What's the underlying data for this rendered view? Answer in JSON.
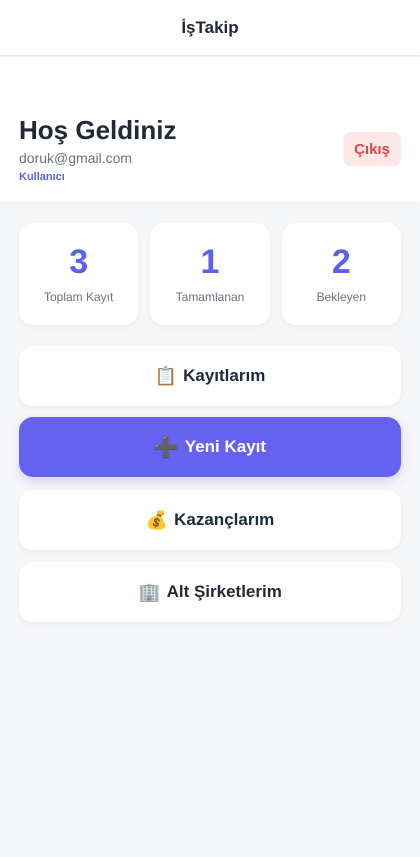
{
  "header": {
    "title": "İşTakip"
  },
  "welcome": {
    "greeting": "Hoş Geldiniz",
    "email": "doruk@gmail.com",
    "role": "Kullanıcı",
    "logout_label": "Çıkış"
  },
  "stats": [
    {
      "value": "3",
      "label": "Toplam Kayıt"
    },
    {
      "value": "1",
      "label": "Tamamlanan"
    },
    {
      "value": "2",
      "label": "Bekleyen"
    }
  ],
  "menu": {
    "records": {
      "icon": "📋",
      "label": "Kayıtlarım"
    },
    "new_record": {
      "icon": "➕",
      "label": "Yeni Kayıt"
    },
    "earnings": {
      "icon": "💰",
      "label": "Kazançlarım"
    },
    "subcompanies": {
      "icon": "🏢",
      "label": "Alt Şirketlerim"
    }
  },
  "colors": {
    "accent": "#5b62e8",
    "primary_button": "#6462ef",
    "logout_bg": "#fde8e8",
    "logout_text": "#e0454b",
    "background": "#f6f7f9"
  }
}
